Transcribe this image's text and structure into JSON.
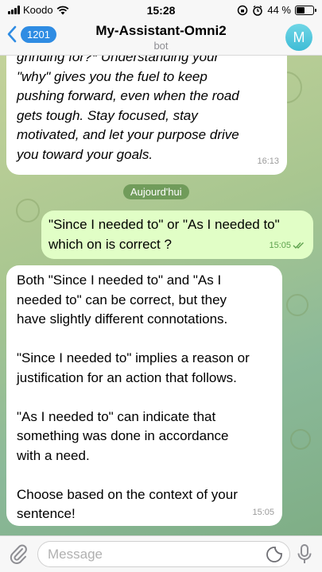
{
  "status_bar": {
    "carrier": "Koodo",
    "time": "15:28",
    "battery_percent": "44 %",
    "battery_level": 0.44
  },
  "header": {
    "back_count": "1201",
    "title": "My-Assistant-Omni2",
    "subtitle": "bot",
    "avatar_letter": "M"
  },
  "chat": {
    "previous_message": {
      "lines": [
        "grinding for?* Understanding your",
        "\"why\" gives you the fuel to keep",
        "pushing forward, even when the road",
        "gets tough. Stay focused, stay",
        "motivated, and let your purpose drive",
        "you toward your goals."
      ],
      "time": "16:13"
    },
    "date_separator": "Aujourd'hui",
    "outgoing_message": {
      "lines": [
        "\"Since I needed to\" or \"As I needed to\"",
        "which on is correct ?"
      ],
      "time": "15:05",
      "status": "read"
    },
    "reply_message": {
      "paragraphs": [
        [
          "Both \"Since I needed to\" and \"As I",
          "needed to\" can be correct, but they",
          "have slightly different connotations."
        ],
        [
          "\"Since I needed to\" implies a reason or",
          "justification for an action that follows."
        ],
        [
          "\"As I needed to\" can indicate that",
          "something was done in accordance",
          "with a need."
        ],
        [
          "Choose based on the context of your",
          "sentence!"
        ]
      ],
      "time": "15:05"
    }
  },
  "input_bar": {
    "placeholder": "Message"
  },
  "colors": {
    "accent": "#2f8ce3",
    "outgoing_bubble": "#e1fec6",
    "incoming_bubble": "#ffffff",
    "date_pill": "#5c8c48"
  }
}
